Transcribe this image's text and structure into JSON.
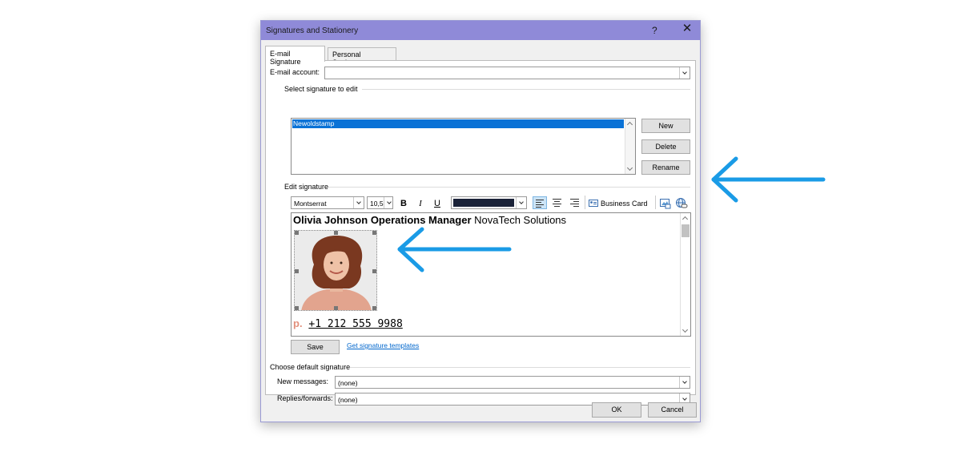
{
  "dialog": {
    "title": "Signatures and Stationery",
    "help_label": "?",
    "close_label": "✕"
  },
  "tabs": [
    {
      "label": "E-mail Signature",
      "active": true
    },
    {
      "label": "Personal Stationery",
      "active": false
    }
  ],
  "email_account": {
    "label": "E-mail account:",
    "value": ""
  },
  "select_section": {
    "label": "Select signature to edit",
    "items": [
      "Newoldstamp"
    ],
    "selected_index": 0
  },
  "side_buttons": {
    "new_label": "New",
    "delete_label": "Delete",
    "rename_label": "Rename"
  },
  "edit_section": {
    "label": "Edit signature",
    "toolbar": {
      "font": "Montserrat",
      "size": "10,5",
      "bold_label": "B",
      "italic_label": "I",
      "underline_label": "U",
      "text_color": "#1a2238",
      "business_card_label": "Business Card"
    },
    "signature": {
      "name": "Olivia Johnson",
      "title": "Operations Manager",
      "company": "NovaTech Solutions",
      "phone_prefix": "p.",
      "phone": "+1 212 555 9988",
      "prefix_color": "#e2907c"
    }
  },
  "bottom_actions": {
    "save_label": "Save",
    "templates_link": "Get signature templates"
  },
  "default_section": {
    "label": "Choose default signature",
    "new_messages_label": "New messages:",
    "new_messages_value": "(none)",
    "replies_label": "Replies/forwards:",
    "replies_value": "(none)"
  },
  "footer": {
    "ok_label": "OK",
    "cancel_label": "Cancel"
  },
  "colors": {
    "titlebar": "#8f8ad8",
    "selection": "#0a72d6",
    "arrow": "#1a9be6"
  }
}
